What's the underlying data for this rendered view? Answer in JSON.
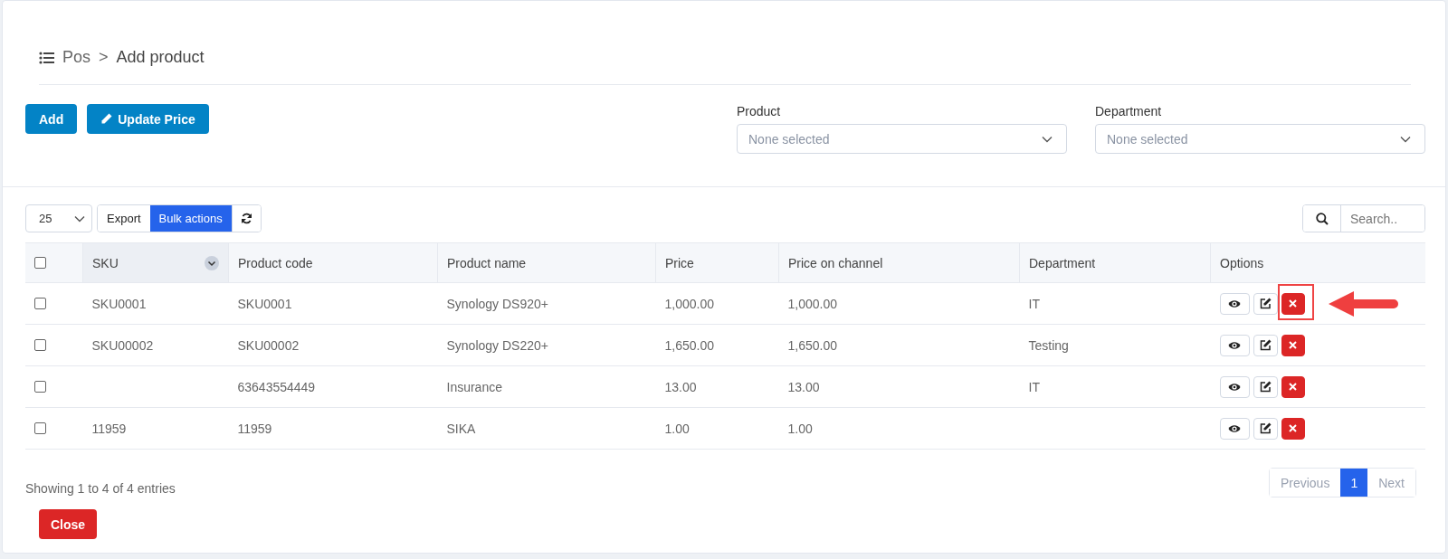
{
  "breadcrumb": {
    "section": "Pos",
    "separator": ">",
    "page": "Add product"
  },
  "actions": [
    "Add",
    "Update Price"
  ],
  "filters": [
    {
      "label": "Product",
      "placeholder": "None selected"
    },
    {
      "label": "Department",
      "placeholder": "None selected"
    }
  ],
  "toolbar": {
    "page_size": "25",
    "buttons": [
      {
        "label": "Export",
        "selected": false
      },
      {
        "label": "Bulk actions",
        "selected": true
      }
    ],
    "search": {
      "placeholder": "Search.."
    }
  },
  "table": {
    "header_checked": false,
    "columns": [
      {
        "label": "SKU",
        "sorted": true
      },
      {
        "label": "Product code",
        "sorted": false
      },
      {
        "label": "Product name",
        "sorted": false
      },
      {
        "label": "Price",
        "sorted": false
      },
      {
        "label": "Price on channel",
        "sorted": false
      },
      {
        "label": "Department",
        "sorted": false
      },
      {
        "label": "Options",
        "sorted": false
      }
    ],
    "rows": [
      {
        "checked": false,
        "highlighted": true,
        "cells": [
          "SKU0001",
          "SKU0001",
          "Synology DS920+",
          "1,000.00",
          "1,000.00",
          "IT"
        ]
      },
      {
        "checked": false,
        "highlighted": false,
        "cells": [
          "SKU00002",
          "SKU00002",
          "Synology DS220+",
          "1,650.00",
          "1,650.00",
          "Testing"
        ]
      },
      {
        "checked": false,
        "highlighted": false,
        "cells": [
          "",
          "63643554449",
          "Insurance",
          "13.00",
          "13.00",
          "IT"
        ]
      },
      {
        "checked": false,
        "highlighted": false,
        "cells": [
          "11959",
          "11959",
          "SIKA",
          "1.00",
          "1.00",
          ""
        ]
      }
    ]
  },
  "footer": {
    "info": "Showing 1 to 4 of 4 entries",
    "pages": [
      {
        "label": "Previous",
        "selected": false
      },
      {
        "label": "1",
        "selected": true
      },
      {
        "label": "Next",
        "selected": false
      }
    ],
    "close": "Close"
  }
}
